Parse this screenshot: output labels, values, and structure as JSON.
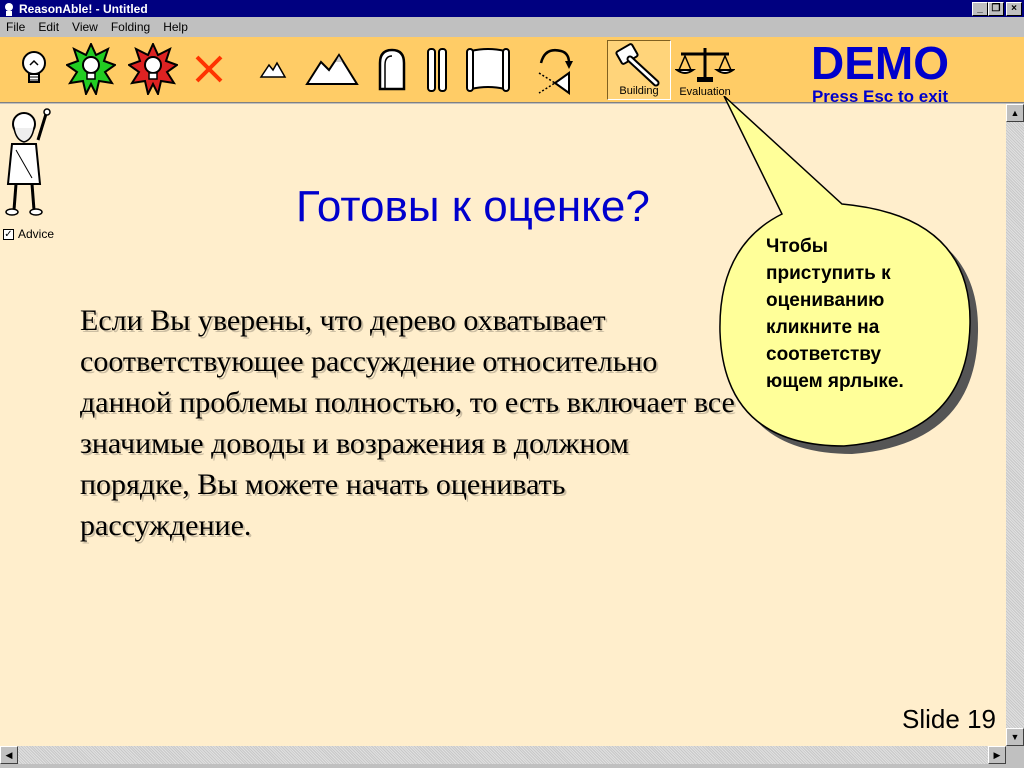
{
  "window": {
    "title": "ReasonAble! - Untitled",
    "minimize": "_",
    "restore": "❐",
    "close": "×"
  },
  "menu": [
    "File",
    "Edit",
    "View",
    "Folding",
    "Help"
  ],
  "toolbar": {
    "building_label": "Building",
    "evaluation_label": "Evaluation",
    "demo_title": "DEMO",
    "demo_hint": "Press Esc to exit"
  },
  "sidebar": {
    "advice_label": "Advice",
    "advice_check": "✓"
  },
  "slide": {
    "heading": "Готовы к оценке?",
    "body": "Если Вы уверены, что дерево охватывает соответствующее рассуждение относительно данной проблемы полностью, то есть включает все значимые доводы и возражения в должном порядке, Вы можете начать оценивать рассуждение.",
    "callout": "Чтобы приступить к оцениванию кликните на соответству ющем ярлыке.",
    "number": "Slide 19"
  },
  "scroll": {
    "up": "▲",
    "down": "▼",
    "left": "◀",
    "right": "▶"
  },
  "colors": {
    "toolbar_bg": "#ffcc66",
    "workspace_bg": "#ffeecc",
    "accent_blue": "#0000cc",
    "callout_fill": "#ffff99"
  }
}
